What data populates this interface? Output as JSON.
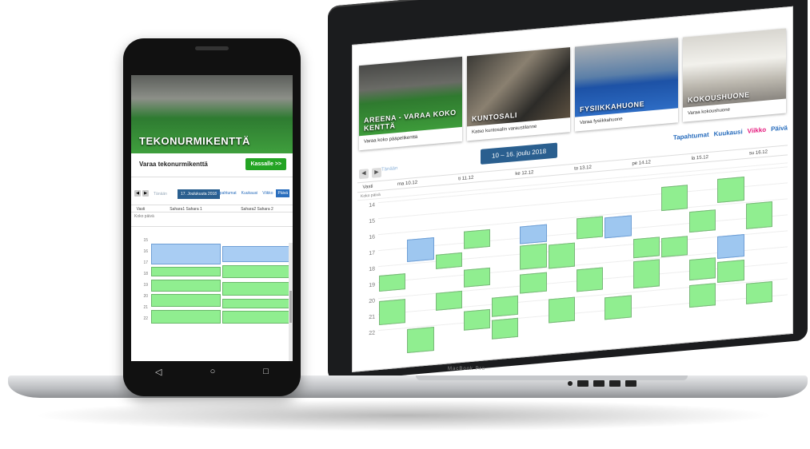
{
  "laptop": {
    "brand": "MacBook Pro",
    "rooms": [
      {
        "overlay": "AREENA - VARAA KOKO KENTTÄ",
        "caption": "Varaa koko pääpelikenttä",
        "img": "img-arena"
      },
      {
        "overlay": "KUNTOSALI",
        "caption": "Katso kuntosalin varaustilanne",
        "img": "img-gym"
      },
      {
        "overlay": "FYSIIKKAHUONE",
        "caption": "Varaa fysiikkahuone",
        "img": "img-fys"
      },
      {
        "overlay": "KOKOUSHUONE",
        "caption": "Varaa kokoushuone",
        "img": "img-meet"
      }
    ],
    "calendar": {
      "date_range": "10 – 16. joulu 2018",
      "today": "Tänään",
      "views": {
        "tap": "Tapahtumat",
        "kuu": "Kuukausi",
        "vii": "Viikko",
        "pai": "Päivä"
      },
      "columns": [
        "Vasti",
        "ma 10.12",
        "ti 11.12",
        "ke 12.12",
        "to 13.12",
        "pe 14.12",
        "la 15.12",
        "su 16.12"
      ],
      "allday": "Koko päivä",
      "hours": [
        "14",
        "15",
        "16",
        "17",
        "18",
        "19",
        "20",
        "21",
        "22"
      ]
    }
  },
  "phone": {
    "hero": "TEKONURMIKENTTÄ",
    "book_label": "Varaa tekonurmikenttä",
    "book_button": "Kassalle >>",
    "toolbar": {
      "today": "Tänään",
      "date": "17. Joulukuuta 2018",
      "views": [
        "Tapahtumat",
        "Kuukausi",
        "Viikko",
        "Päivä"
      ]
    },
    "columns": [
      "Vasti",
      "Sahara1 Sahara 1",
      "Sahara2 Sahara 2"
    ],
    "allday": "Koko päivä",
    "hours": [
      "15",
      "16",
      "17",
      "18",
      "19",
      "20",
      "21",
      "22"
    ],
    "nav": {
      "back": "◁",
      "home": "○",
      "recent": "□"
    }
  }
}
